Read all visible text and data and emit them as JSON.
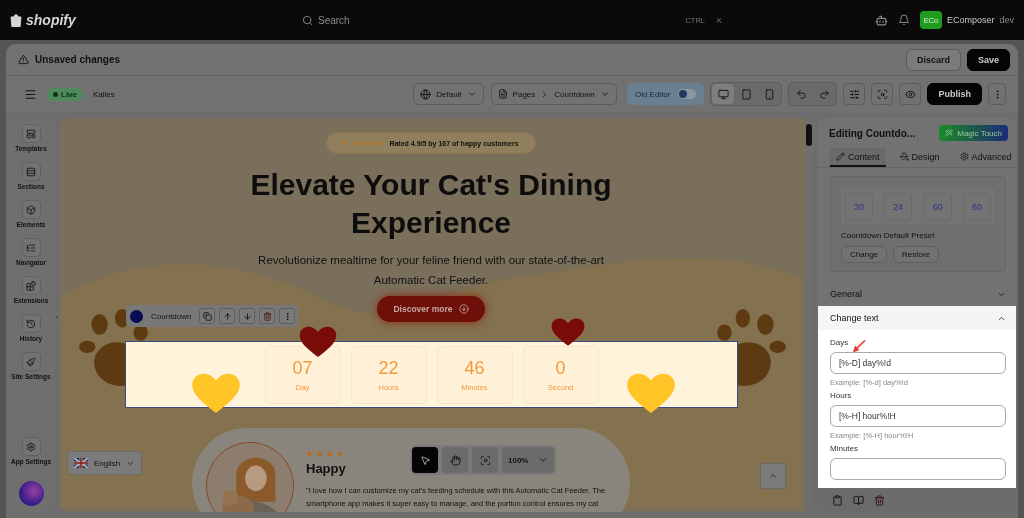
{
  "topbar": {
    "brand": "shopify",
    "search": {
      "placeholder": "Search"
    },
    "shortcut": [
      "CTRL",
      "K"
    ],
    "account": {
      "initials": "ECo",
      "name": "EComposer",
      "store": "dev"
    }
  },
  "notice": {
    "text": "Unsaved changes",
    "buttons": [
      {
        "label": "Discard",
        "kind": "secondary"
      },
      {
        "label": "Save",
        "kind": "primary"
      }
    ]
  },
  "toolbar": {
    "status": {
      "label": "Live",
      "kind": "live"
    },
    "store": "Kalles",
    "theme_select": "Default",
    "breadcrumb": [
      "Pages",
      "Countdown"
    ],
    "old_editor": {
      "label": "Old Editor",
      "on": false
    },
    "devices": [
      {
        "kind": "desktop",
        "selected": true
      },
      {
        "kind": "tablet",
        "selected": false
      },
      {
        "kind": "mobile",
        "selected": false
      }
    ],
    "publish": "Publish"
  },
  "sidebar": {
    "items": [
      {
        "label": "Templates",
        "kind": "templates"
      },
      {
        "label": "Sections",
        "kind": "sections"
      },
      {
        "label": "Elements",
        "kind": "elements"
      },
      {
        "label": "Navigator",
        "kind": "navigator"
      },
      {
        "label": "Extensions",
        "kind": "extensions"
      },
      {
        "label": "History",
        "kind": "history"
      },
      {
        "label": "Site Settings",
        "kind": "site"
      }
    ],
    "footer": {
      "label": "App Settings"
    }
  },
  "canvas": {
    "rating": {
      "stars": 5,
      "text": "Rated 4.9/5 by 167 of happy customers"
    },
    "headline": "Elevate Your Cat's Dining Experience",
    "subtitle": "Revolutionize mealtime for your feline friend with our state-of-the-art Automatic Cat Feeder.",
    "cta": "Discover more",
    "element_toolbar": {
      "label": "Countdown"
    },
    "countdown": [
      {
        "value": "07",
        "unit": "Day"
      },
      {
        "value": "22",
        "unit": "Hours"
      },
      {
        "value": "46",
        "unit": "Minutes"
      },
      {
        "value": "0",
        "unit": "Second"
      }
    ],
    "testimonial": {
      "stars": 4,
      "name": "Happy",
      "quote": "\"I love how I can customize my cat's feeding schedule with this Automatic Cat Feeder. The smartphone app makes it super easy to manage, and the portion control ensures my cat"
    },
    "view_tools": {
      "tools": [
        {
          "kind": "pointer",
          "selected": true
        },
        {
          "kind": "hand",
          "selected": false
        },
        {
          "kind": "fit",
          "selected": false
        }
      ],
      "zoom": "100%"
    },
    "language": "English"
  },
  "panel": {
    "title": "Editing Countdo...",
    "magic": "Magic Touch",
    "tabs": [
      {
        "label": "Content",
        "kind": "content",
        "selected": true
      },
      {
        "label": "Design",
        "kind": "design",
        "selected": false
      },
      {
        "label": "Advanced",
        "kind": "advanced",
        "selected": false
      }
    ],
    "preset": {
      "values": [
        "30",
        "24",
        "60",
        "60"
      ],
      "name": "Countdown Default Preset",
      "buttons": [
        "Change",
        "Restore"
      ]
    },
    "sections": [
      {
        "title": "General",
        "expanded": false
      },
      {
        "title": "Change text",
        "expanded": true,
        "fields": [
          {
            "label": "Days",
            "value": "[%-D] day%!d",
            "example": "Example: [%-d] day%!d",
            "annotated": true
          },
          {
            "label": "Hours",
            "value": "[%-H] hour%!H",
            "example": "Example: [%-H] hour%!H",
            "annotated": false
          },
          {
            "label": "Minutes",
            "annotated": false
          }
        ]
      }
    ]
  }
}
